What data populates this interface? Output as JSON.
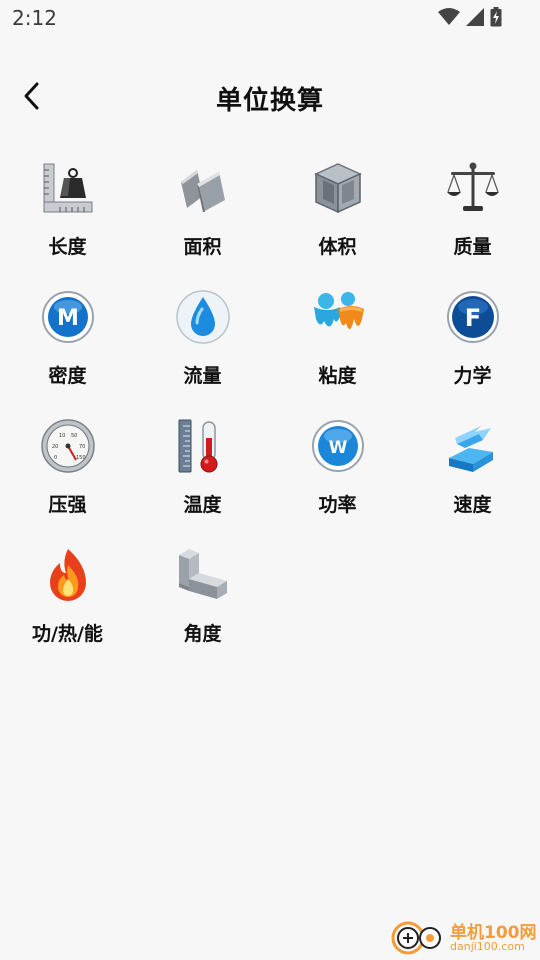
{
  "status": {
    "time": "2:12",
    "icons": [
      "wifi-icon",
      "cell-signal-icon",
      "battery-charging-icon"
    ]
  },
  "header": {
    "title": "单位换算",
    "back_icon": "chevron-left-icon"
  },
  "categories": [
    {
      "label": "长度",
      "icon": "ruler-weight-icon"
    },
    {
      "label": "面积",
      "icon": "panels-icon"
    },
    {
      "label": "体积",
      "icon": "cube-icon"
    },
    {
      "label": "质量",
      "icon": "scale-icon"
    },
    {
      "label": "密度",
      "icon": "m-badge-icon"
    },
    {
      "label": "流量",
      "icon": "water-drop-icon"
    },
    {
      "label": "粘度",
      "icon": "drip-icon"
    },
    {
      "label": "力学",
      "icon": "f-badge-icon"
    },
    {
      "label": "压强",
      "icon": "pressure-gauge-icon"
    },
    {
      "label": "温度",
      "icon": "thermometer-icon"
    },
    {
      "label": "功率",
      "icon": "w-badge-icon"
    },
    {
      "label": "速度",
      "icon": "speed-block-icon"
    },
    {
      "label": "功/热/能",
      "icon": "flame-icon"
    },
    {
      "label": "角度",
      "icon": "angle-block-icon"
    }
  ],
  "watermark": {
    "brand": "单机100网",
    "url": "danji100.com",
    "accent": "#f39c38"
  }
}
